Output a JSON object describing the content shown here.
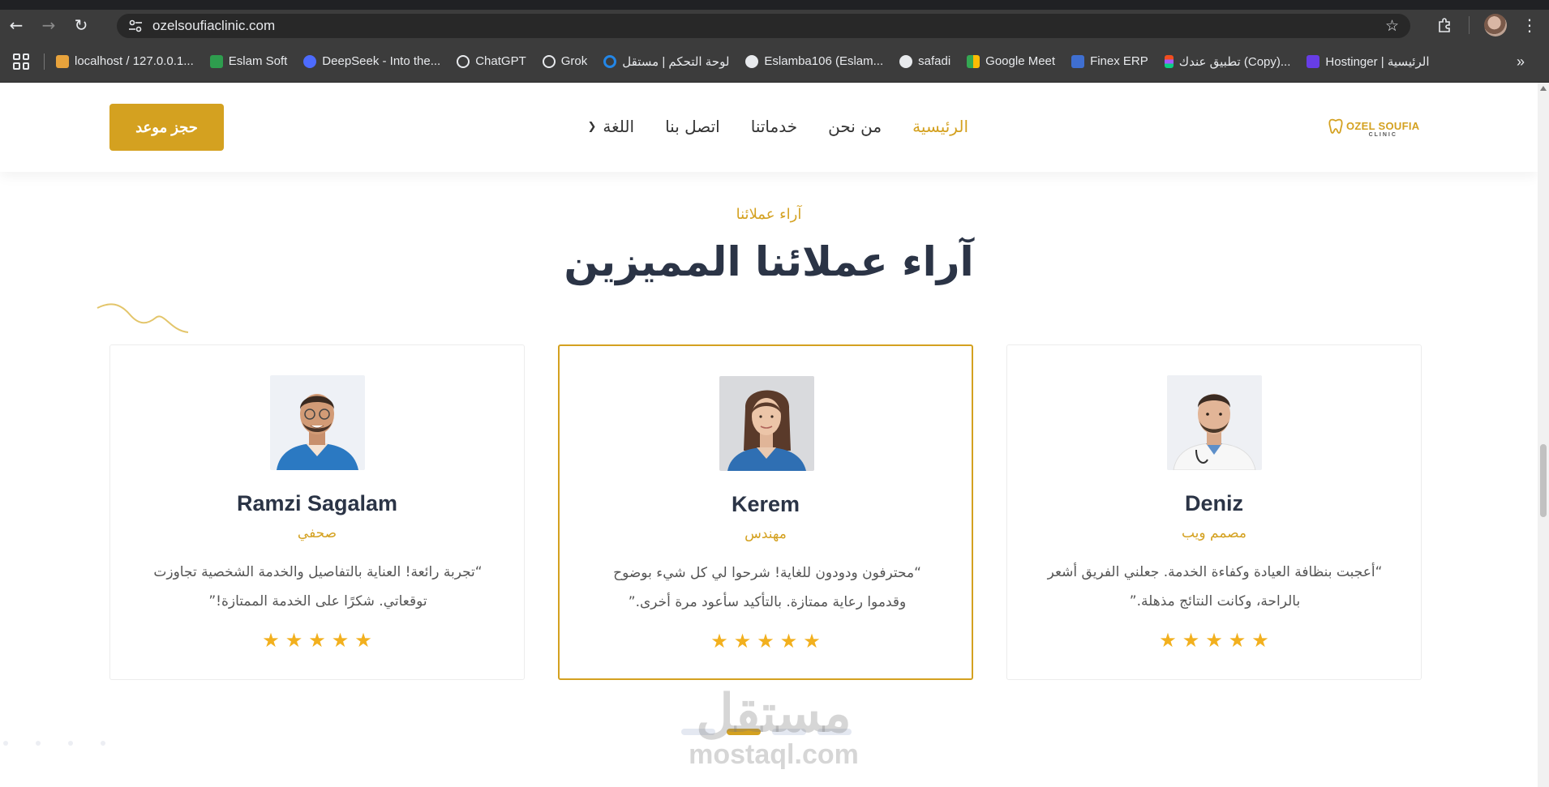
{
  "browser": {
    "url": "ozelsoufiaclinic.com",
    "bookmarks": [
      {
        "label": "localhost / 127.0.0.1...",
        "color": "#e8a33c"
      },
      {
        "label": "Eslam Soft",
        "color": "#2e9d4e"
      },
      {
        "label": "DeepSeek - Into the...",
        "color": "#4d6bfe"
      },
      {
        "label": "ChatGPT",
        "color": "#e8eaed"
      },
      {
        "label": "Grok",
        "color": "#e8eaed"
      },
      {
        "label": "لوحة التحكم | مستقل",
        "color": "#2386e6"
      },
      {
        "label": "Eslamba106 (Eslam...",
        "color": "#e8eaed"
      },
      {
        "label": "safadi",
        "color": "#e8eaed"
      },
      {
        "label": "Google Meet",
        "color": "#34a853"
      },
      {
        "label": "Finex ERP",
        "color": "#3f6fd1"
      },
      {
        "label": "تطبيق عندك (Copy)...",
        "color": "#f24e1e"
      },
      {
        "label": "Hostinger | الرئيسية",
        "color": "#673de6"
      }
    ]
  },
  "header": {
    "logo": {
      "line1": "OZEL SOUFIA",
      "line2": "CLINIC"
    },
    "nav": {
      "home": "الرئيسية",
      "about": "من نحن",
      "services": "خدماتنا",
      "contact": "اتصل بنا",
      "language": "اللغة"
    },
    "book_button": "حجز موعد"
  },
  "section": {
    "eyebrow": "آراء عملائنا",
    "title": "آراء عملائنا المميزين"
  },
  "testimonials": [
    {
      "name": "Ramzi Sagalam",
      "role": "صحفي",
      "quote": "“تجربة رائعة! العناية بالتفاصيل والخدمة الشخصية تجاوزت توقعاتي. شكرًا على الخدمة الممتازة!”",
      "rating": 5
    },
    {
      "name": "Kerem",
      "role": "مهندس",
      "quote": "“محترفون ودودون للغاية! شرحوا لي كل شيء بوضوح وقدموا رعاية ممتازة. بالتأكيد سأعود مرة أخرى.”",
      "rating": 5
    },
    {
      "name": "Deniz",
      "role": "مصمم ويب",
      "quote": "“أعجبت بنظافة العيادة وكفاءة الخدمة. جعلني الفريق أشعر بالراحة، وكانت النتائج مذهلة.”",
      "rating": 5
    }
  ],
  "watermark": {
    "arabic": "مستقل",
    "latin": "mostaql.com"
  },
  "colors": {
    "accent": "#d4a120",
    "heading": "#2b3446",
    "star": "#f2b01e"
  }
}
